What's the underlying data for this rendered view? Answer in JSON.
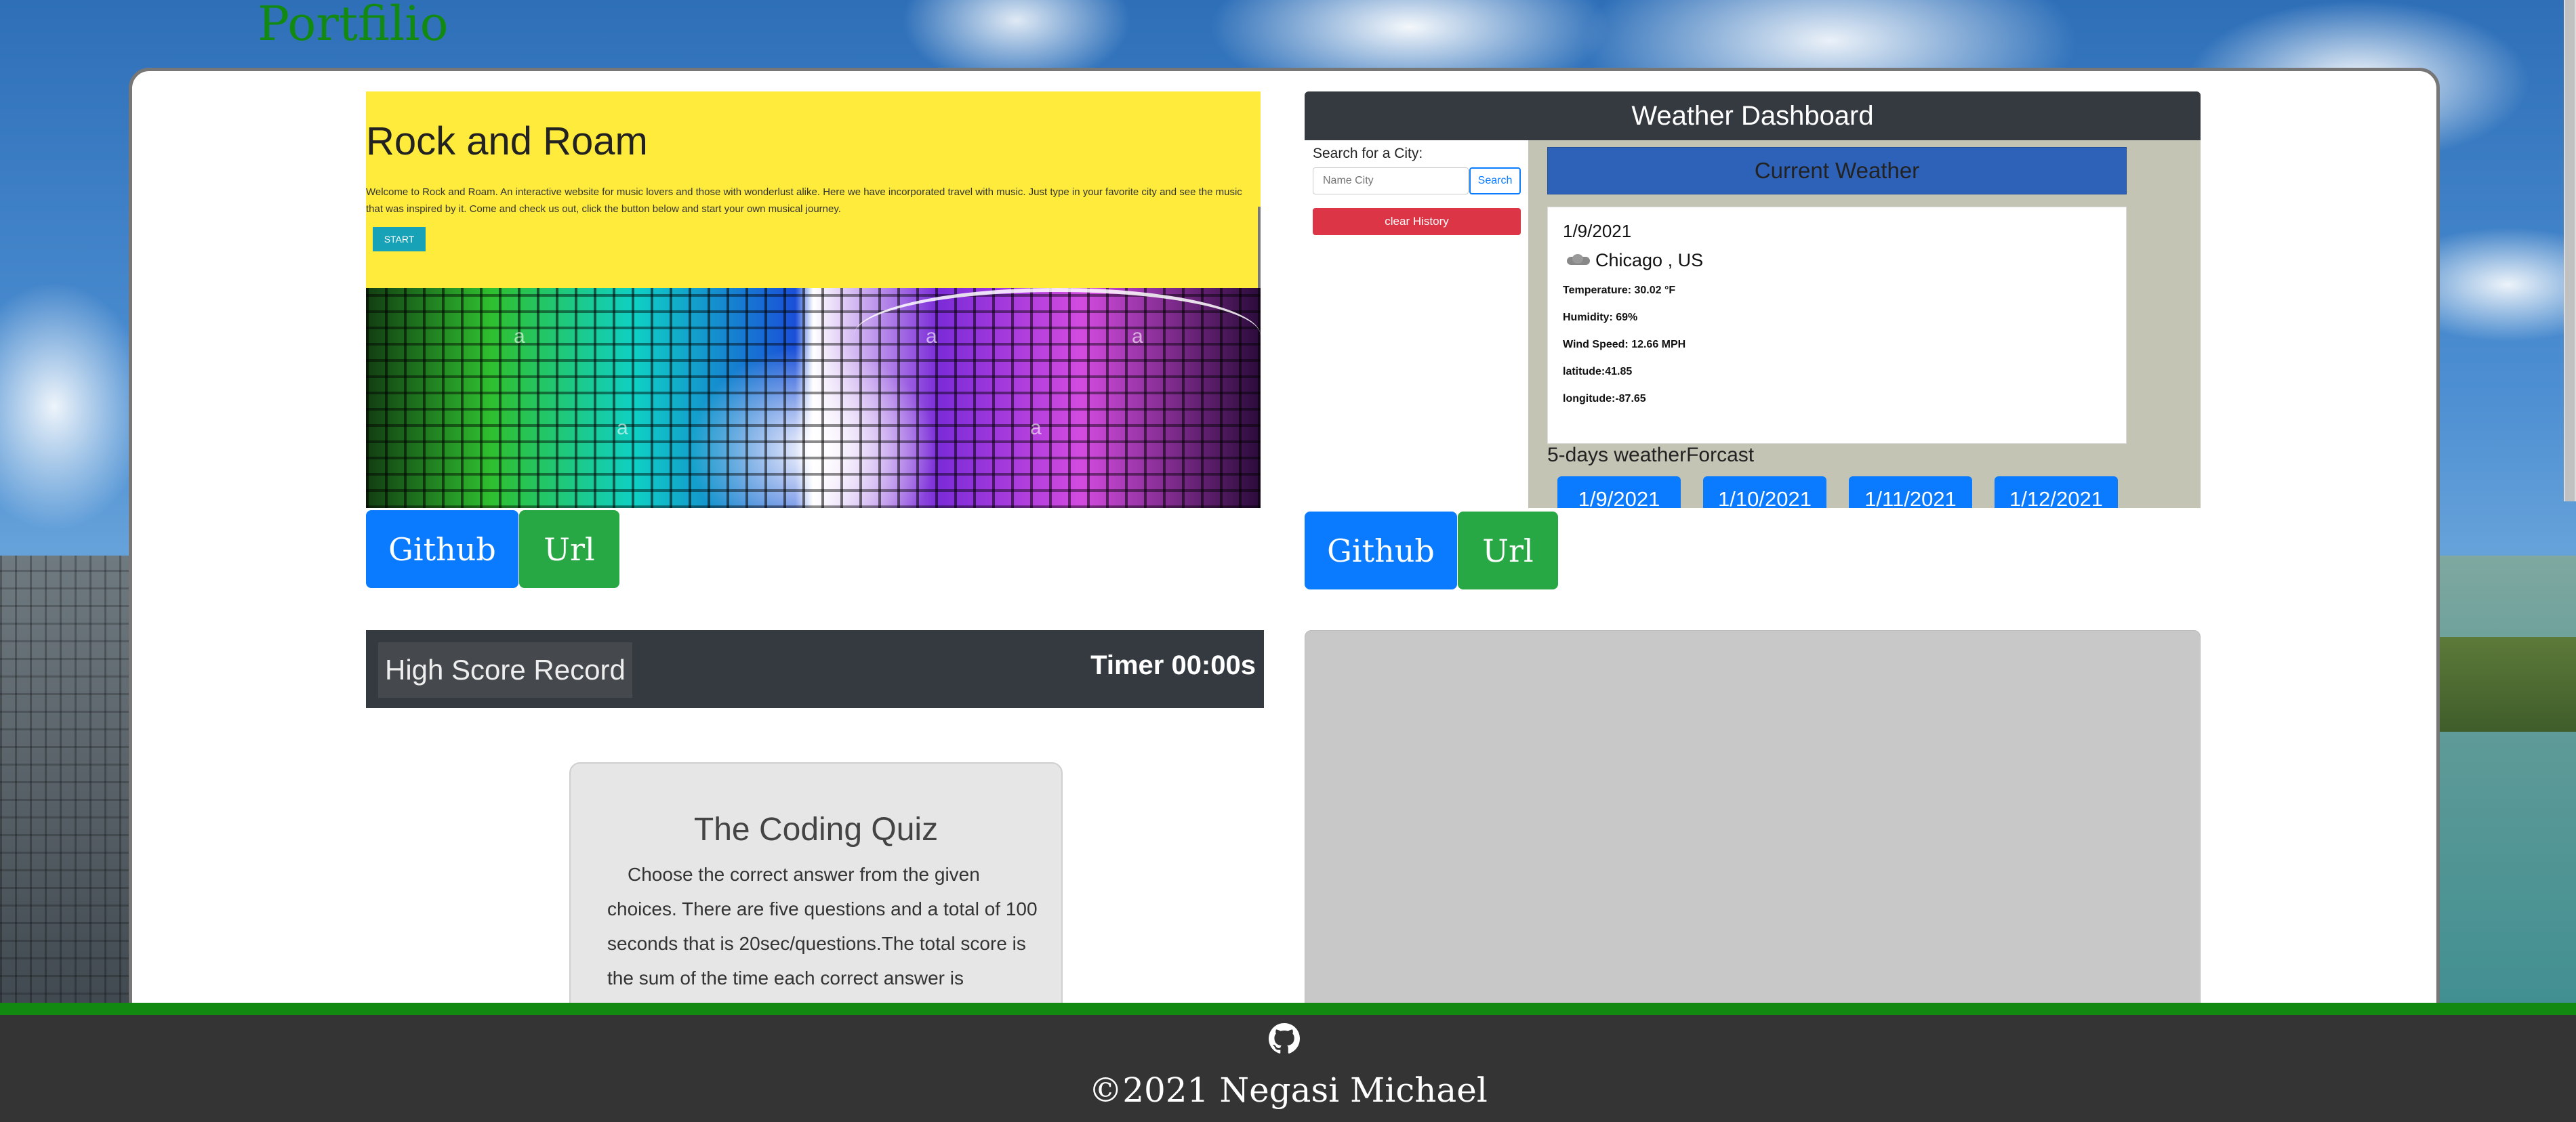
{
  "header": {
    "title": "Portfilio"
  },
  "projects": {
    "rock_and_roam": {
      "title": "Rock and Roam",
      "description": "Welcome to Rock and Roam. An interactive website for music lovers and those with wonderlust alike. Here we have incorporated travel with music. Just type in your favorite city and see the music that was inspired by it. Come and check us out, click the button below and start your own musical journey.",
      "start_label": "START",
      "watermark": "a",
      "github_label": "Github",
      "url_label": "Url"
    },
    "weather": {
      "title": "Weather Dashboard",
      "search_label": "Search for a City:",
      "search_placeholder": "Name City",
      "search_button": "Search",
      "clear_button": "clear History",
      "current_heading": "Current Weather",
      "date": "1/9/2021",
      "city": "Chicago , US",
      "icon": "cloud-icon",
      "temperature": "Temperature: 30.02 °F",
      "humidity": "Humidity: 69%",
      "wind": "Wind Speed: 12.66 MPH",
      "latitude": "latitude:41.85",
      "longitude": "longitude:-87.65",
      "forecast_title": "5-days weatherForcast",
      "forecast_dates": [
        "1/9/2021",
        "1/10/2021",
        "1/11/2021",
        "1/12/2021"
      ],
      "github_label": "Github",
      "url_label": "Url"
    },
    "quiz": {
      "high_score_label": "High Score Record",
      "timer": "Timer 00:00s",
      "title": "The Coding Quiz",
      "description": "Choose the correct answer from the given choices. There are five questions and a total of 100 seconds that is 20sec/questions.The total score is the sum of the time each correct answer is answered."
    }
  },
  "footer": {
    "icon": "github-icon",
    "copyright": "©2021 Negasi Michael"
  },
  "colors": {
    "title_green": "#128a12",
    "github_blue": "#0a7bff",
    "url_green": "#28a745",
    "footer_bg": "#343434"
  }
}
